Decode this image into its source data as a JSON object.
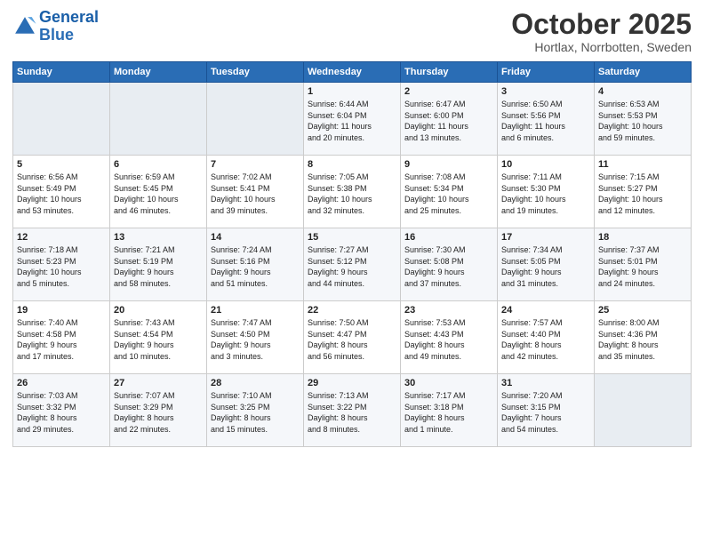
{
  "logo": {
    "line1": "General",
    "line2": "Blue"
  },
  "title": "October 2025",
  "subtitle": "Hortlax, Norrbotten, Sweden",
  "days_header": [
    "Sunday",
    "Monday",
    "Tuesday",
    "Wednesday",
    "Thursday",
    "Friday",
    "Saturday"
  ],
  "weeks": [
    [
      {
        "num": "",
        "info": ""
      },
      {
        "num": "",
        "info": ""
      },
      {
        "num": "",
        "info": ""
      },
      {
        "num": "1",
        "info": "Sunrise: 6:44 AM\nSunset: 6:04 PM\nDaylight: 11 hours\nand 20 minutes."
      },
      {
        "num": "2",
        "info": "Sunrise: 6:47 AM\nSunset: 6:00 PM\nDaylight: 11 hours\nand 13 minutes."
      },
      {
        "num": "3",
        "info": "Sunrise: 6:50 AM\nSunset: 5:56 PM\nDaylight: 11 hours\nand 6 minutes."
      },
      {
        "num": "4",
        "info": "Sunrise: 6:53 AM\nSunset: 5:53 PM\nDaylight: 10 hours\nand 59 minutes."
      }
    ],
    [
      {
        "num": "5",
        "info": "Sunrise: 6:56 AM\nSunset: 5:49 PM\nDaylight: 10 hours\nand 53 minutes."
      },
      {
        "num": "6",
        "info": "Sunrise: 6:59 AM\nSunset: 5:45 PM\nDaylight: 10 hours\nand 46 minutes."
      },
      {
        "num": "7",
        "info": "Sunrise: 7:02 AM\nSunset: 5:41 PM\nDaylight: 10 hours\nand 39 minutes."
      },
      {
        "num": "8",
        "info": "Sunrise: 7:05 AM\nSunset: 5:38 PM\nDaylight: 10 hours\nand 32 minutes."
      },
      {
        "num": "9",
        "info": "Sunrise: 7:08 AM\nSunset: 5:34 PM\nDaylight: 10 hours\nand 25 minutes."
      },
      {
        "num": "10",
        "info": "Sunrise: 7:11 AM\nSunset: 5:30 PM\nDaylight: 10 hours\nand 19 minutes."
      },
      {
        "num": "11",
        "info": "Sunrise: 7:15 AM\nSunset: 5:27 PM\nDaylight: 10 hours\nand 12 minutes."
      }
    ],
    [
      {
        "num": "12",
        "info": "Sunrise: 7:18 AM\nSunset: 5:23 PM\nDaylight: 10 hours\nand 5 minutes."
      },
      {
        "num": "13",
        "info": "Sunrise: 7:21 AM\nSunset: 5:19 PM\nDaylight: 9 hours\nand 58 minutes."
      },
      {
        "num": "14",
        "info": "Sunrise: 7:24 AM\nSunset: 5:16 PM\nDaylight: 9 hours\nand 51 minutes."
      },
      {
        "num": "15",
        "info": "Sunrise: 7:27 AM\nSunset: 5:12 PM\nDaylight: 9 hours\nand 44 minutes."
      },
      {
        "num": "16",
        "info": "Sunrise: 7:30 AM\nSunset: 5:08 PM\nDaylight: 9 hours\nand 37 minutes."
      },
      {
        "num": "17",
        "info": "Sunrise: 7:34 AM\nSunset: 5:05 PM\nDaylight: 9 hours\nand 31 minutes."
      },
      {
        "num": "18",
        "info": "Sunrise: 7:37 AM\nSunset: 5:01 PM\nDaylight: 9 hours\nand 24 minutes."
      }
    ],
    [
      {
        "num": "19",
        "info": "Sunrise: 7:40 AM\nSunset: 4:58 PM\nDaylight: 9 hours\nand 17 minutes."
      },
      {
        "num": "20",
        "info": "Sunrise: 7:43 AM\nSunset: 4:54 PM\nDaylight: 9 hours\nand 10 minutes."
      },
      {
        "num": "21",
        "info": "Sunrise: 7:47 AM\nSunset: 4:50 PM\nDaylight: 9 hours\nand 3 minutes."
      },
      {
        "num": "22",
        "info": "Sunrise: 7:50 AM\nSunset: 4:47 PM\nDaylight: 8 hours\nand 56 minutes."
      },
      {
        "num": "23",
        "info": "Sunrise: 7:53 AM\nSunset: 4:43 PM\nDaylight: 8 hours\nand 49 minutes."
      },
      {
        "num": "24",
        "info": "Sunrise: 7:57 AM\nSunset: 4:40 PM\nDaylight: 8 hours\nand 42 minutes."
      },
      {
        "num": "25",
        "info": "Sunrise: 8:00 AM\nSunset: 4:36 PM\nDaylight: 8 hours\nand 35 minutes."
      }
    ],
    [
      {
        "num": "26",
        "info": "Sunrise: 7:03 AM\nSunset: 3:32 PM\nDaylight: 8 hours\nand 29 minutes."
      },
      {
        "num": "27",
        "info": "Sunrise: 7:07 AM\nSunset: 3:29 PM\nDaylight: 8 hours\nand 22 minutes."
      },
      {
        "num": "28",
        "info": "Sunrise: 7:10 AM\nSunset: 3:25 PM\nDaylight: 8 hours\nand 15 minutes."
      },
      {
        "num": "29",
        "info": "Sunrise: 7:13 AM\nSunset: 3:22 PM\nDaylight: 8 hours\nand 8 minutes."
      },
      {
        "num": "30",
        "info": "Sunrise: 7:17 AM\nSunset: 3:18 PM\nDaylight: 8 hours\nand 1 minute."
      },
      {
        "num": "31",
        "info": "Sunrise: 7:20 AM\nSunset: 3:15 PM\nDaylight: 7 hours\nand 54 minutes."
      },
      {
        "num": "",
        "info": ""
      }
    ]
  ]
}
